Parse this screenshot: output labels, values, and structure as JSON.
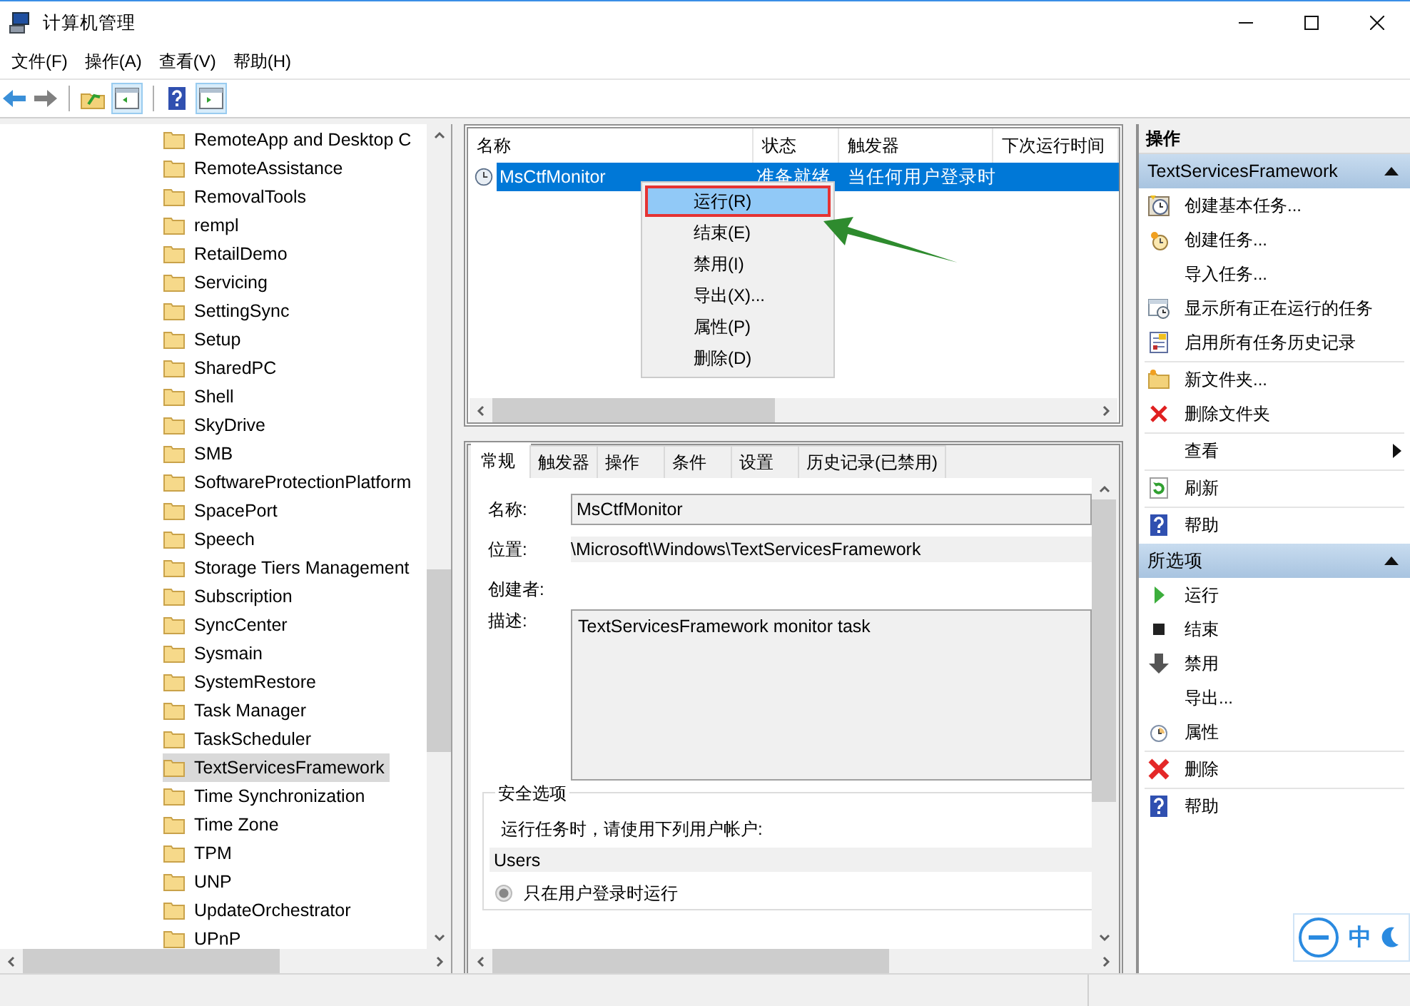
{
  "window": {
    "title": "计算机管理"
  },
  "menu": [
    "文件(F)",
    "操作(A)",
    "查看(V)",
    "帮助(H)"
  ],
  "tree": {
    "items": [
      {
        "label": "RemoteApp and Desktop C",
        "selected": false
      },
      {
        "label": "RemoteAssistance",
        "selected": false
      },
      {
        "label": "RemovalTools",
        "selected": false
      },
      {
        "label": "rempl",
        "selected": false
      },
      {
        "label": "RetailDemo",
        "selected": false
      },
      {
        "label": "Servicing",
        "selected": false
      },
      {
        "label": "SettingSync",
        "selected": false
      },
      {
        "label": "Setup",
        "selected": false
      },
      {
        "label": "SharedPC",
        "selected": false
      },
      {
        "label": "Shell",
        "selected": false
      },
      {
        "label": "SkyDrive",
        "selected": false
      },
      {
        "label": "SMB",
        "selected": false
      },
      {
        "label": "SoftwareProtectionPlatform",
        "selected": false
      },
      {
        "label": "SpacePort",
        "selected": false
      },
      {
        "label": "Speech",
        "selected": false
      },
      {
        "label": "Storage Tiers Management",
        "selected": false
      },
      {
        "label": "Subscription",
        "selected": false
      },
      {
        "label": "SyncCenter",
        "selected": false
      },
      {
        "label": "Sysmain",
        "selected": false
      },
      {
        "label": "SystemRestore",
        "selected": false
      },
      {
        "label": "Task Manager",
        "selected": false
      },
      {
        "label": "TaskScheduler",
        "selected": false
      },
      {
        "label": "TextServicesFramework",
        "selected": true
      },
      {
        "label": "Time Synchronization",
        "selected": false
      },
      {
        "label": "Time Zone",
        "selected": false
      },
      {
        "label": "TPM",
        "selected": false
      },
      {
        "label": "UNP",
        "selected": false
      },
      {
        "label": "UpdateOrchestrator",
        "selected": false
      },
      {
        "label": "UPnP",
        "selected": false
      }
    ]
  },
  "task_list": {
    "columns": [
      "名称",
      "状态",
      "触发器",
      "下次运行时间"
    ],
    "rows": [
      {
        "name": "MsCtfMonitor",
        "status": "准备就绪",
        "trigger": "当任何用户登录时",
        "selected": true
      }
    ]
  },
  "context_menu": [
    {
      "label": "运行(R)",
      "selected": true
    },
    {
      "label": "结束(E)",
      "selected": false
    },
    {
      "label": "禁用(I)",
      "selected": false
    },
    {
      "label": "导出(X)...",
      "selected": false
    },
    {
      "label": "属性(P)",
      "selected": false
    },
    {
      "label": "删除(D)",
      "selected": false
    }
  ],
  "detail_tabs": [
    {
      "label": "常规",
      "selected": true
    },
    {
      "label": "触发器",
      "selected": false
    },
    {
      "label": "操作",
      "selected": false
    },
    {
      "label": "条件",
      "selected": false
    },
    {
      "label": "设置",
      "selected": false
    },
    {
      "label": "历史记录(已禁用)",
      "selected": false
    }
  ],
  "general": {
    "name_label": "名称:",
    "name_value": "MsCtfMonitor",
    "location_label": "位置:",
    "location_value": "\\Microsoft\\Windows\\TextServicesFramework",
    "author_label": "创建者:",
    "description_label": "描述:",
    "description_value": "TextServicesFramework monitor task",
    "security": {
      "legend": "安全选项",
      "prompt": "运行任务时，请使用下列用户帐户:",
      "account": "Users",
      "options": [
        {
          "label": "只在用户登录时运行",
          "selected": true
        }
      ]
    }
  },
  "actions": {
    "title": "操作",
    "sections": [
      {
        "title": "TextServicesFramework",
        "expanded": true,
        "groups": [
          [
            {
              "label": "创建基本任务...",
              "kind": "wizard"
            },
            {
              "label": "创建任务...",
              "kind": "clockstar"
            },
            {
              "label": "导入任务...",
              "kind": "plain"
            },
            {
              "label": "显示所有正在运行的任务",
              "kind": "windowclock"
            },
            {
              "label": "启用所有任务历史记录",
              "kind": "log"
            }
          ],
          [
            {
              "label": "新文件夹...",
              "kind": "folder"
            },
            {
              "label": "删除文件夹",
              "kind": "cross"
            }
          ],
          [
            {
              "label": "查看",
              "kind": "plain",
              "submenu": true
            }
          ],
          [
            {
              "label": "刷新",
              "kind": "refresh"
            }
          ],
          [
            {
              "label": "帮助",
              "kind": "help"
            }
          ]
        ]
      },
      {
        "title": "所选项",
        "expanded": true,
        "groups": [
          [
            {
              "label": "运行",
              "kind": "play"
            },
            {
              "label": "结束",
              "kind": "stop"
            },
            {
              "label": "禁用",
              "kind": "down"
            },
            {
              "label": "导出...",
              "kind": "plain"
            },
            {
              "label": "属性",
              "kind": "clock"
            }
          ],
          [
            {
              "label": "删除",
              "kind": "crossbig"
            }
          ],
          [
            {
              "label": "帮助",
              "kind": "help"
            }
          ]
        ]
      }
    ]
  },
  "ime": {
    "mode": "中"
  }
}
